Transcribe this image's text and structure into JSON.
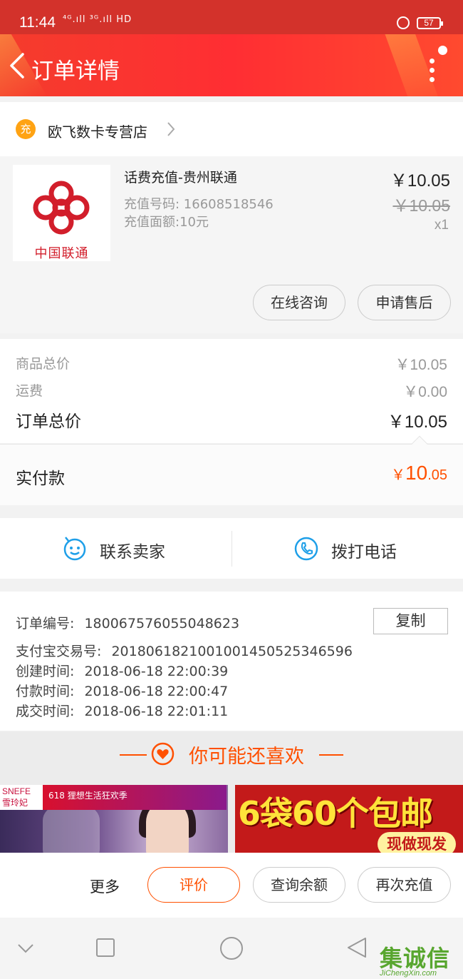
{
  "status_bar": {
    "time": "11:44",
    "signal": "⁴ᴳ.ıll ³ᴳ.ıll HD",
    "battery": "57"
  },
  "header": {
    "title": "订单详情"
  },
  "shop": {
    "icon_char": "充",
    "name": "欧飞数卡专营店"
  },
  "item": {
    "logo_text": "中国联通",
    "name": "话费充值-贵州联通",
    "recharge_number": "充值号码: 16608518546",
    "face_value": "充值面额:10元",
    "price": "￥10.05",
    "original_price": "￥10.05",
    "quantity": "x1",
    "buttons": {
      "consult": "在线咨询",
      "after_sale": "申请售后"
    }
  },
  "summary": {
    "goods_total_label": "商品总价",
    "goods_total": "￥10.05",
    "shipping_label": "运费",
    "shipping": "￥0.00",
    "order_total_label": "订单总价",
    "order_total": "￥10.05",
    "paid_label": "实付款",
    "paid_yen": "￥",
    "paid_int": "10",
    "paid_dec": ".05"
  },
  "contact": {
    "seller": "联系卖家",
    "call": "拨打电话"
  },
  "order_info": {
    "order_no_label": "订单编号:",
    "order_no": "180067576055048623",
    "copy": "复制",
    "alipay_label": "支付宝交易号:",
    "alipay_no": "2018061821001001450525346596",
    "created_label": "创建时间:",
    "created": "2018-06-18 22:00:39",
    "paid_label": "付款时间:",
    "paid": "2018-06-18 22:00:47",
    "done_label": "成交时间:",
    "done": "2018-06-18 22:01:11"
  },
  "recommend": {
    "heading": "你可能还喜欢",
    "card1": {
      "brand": "SNEFE 雪玲妃",
      "badge": "618 狸想生活狂欢季"
    },
    "card2": {
      "headline": "6袋60个包邮",
      "tag": "现做现发"
    }
  },
  "actions": {
    "more": "更多",
    "review": "评价",
    "balance": "查询余额",
    "recharge_again": "再次充值"
  },
  "watermark": {
    "zh": "集诚信",
    "en": "JiChengXin.com"
  },
  "colors": {
    "header_red": "#ff2e33",
    "accent_orange": "#ff5000",
    "unicom_red": "#d21e2b",
    "icon_blue": "#1e9fe8"
  }
}
